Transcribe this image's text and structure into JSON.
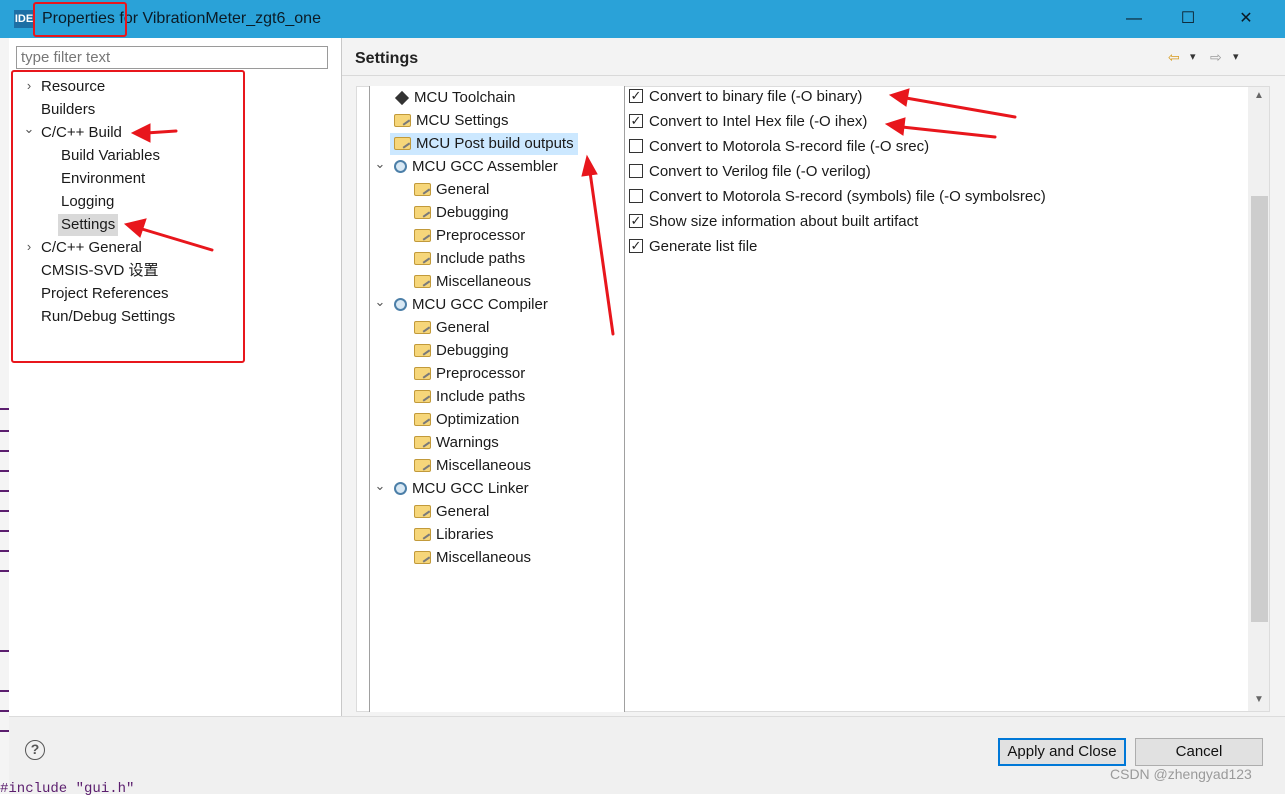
{
  "window": {
    "app_icon_text": "IDE",
    "title": "Properties for VibrationMeter_zgt6_one",
    "minimize": "—",
    "maximize": "☐",
    "close": "✕"
  },
  "filter": {
    "placeholder": "type filter text"
  },
  "left_tree": [
    {
      "label": "Resource",
      "twisty": "›"
    },
    {
      "label": "Builders",
      "twisty": ""
    },
    {
      "label": "C/C++ Build",
      "twisty": "⌄"
    },
    {
      "label": "Build Variables",
      "twisty": ""
    },
    {
      "label": "Environment",
      "twisty": ""
    },
    {
      "label": "Logging",
      "twisty": ""
    },
    {
      "label": "Settings",
      "twisty": "",
      "selected": true
    },
    {
      "label": "C/C++ General",
      "twisty": "›"
    },
    {
      "label": "CMSIS-SVD 设置",
      "twisty": ""
    },
    {
      "label": "Project References",
      "twisty": ""
    },
    {
      "label": "Run/Debug Settings",
      "twisty": ""
    }
  ],
  "page_title": "Settings",
  "nav": {
    "back": "⇦",
    "forward": "⇨",
    "menu": "▾"
  },
  "sub_tree": [
    {
      "label": "MCU Toolchain",
      "icon": "chip-icon"
    },
    {
      "label": "MCU Settings",
      "icon": "folder-settings-icon"
    },
    {
      "label": "MCU Post build outputs",
      "icon": "folder-settings-icon",
      "selected": true
    },
    {
      "label": "MCU GCC Assembler",
      "icon": "tool-gear-icon",
      "twisty": "⌄"
    },
    {
      "label": "General",
      "icon": "folder-settings-icon"
    },
    {
      "label": "Debugging",
      "icon": "folder-settings-icon"
    },
    {
      "label": "Preprocessor",
      "icon": "folder-settings-icon"
    },
    {
      "label": "Include paths",
      "icon": "folder-settings-icon"
    },
    {
      "label": "Miscellaneous",
      "icon": "folder-settings-icon"
    },
    {
      "label": "MCU GCC Compiler",
      "icon": "tool-gear-icon",
      "twisty": "⌄"
    },
    {
      "label": "General",
      "icon": "folder-settings-icon"
    },
    {
      "label": "Debugging",
      "icon": "folder-settings-icon"
    },
    {
      "label": "Preprocessor",
      "icon": "folder-settings-icon"
    },
    {
      "label": "Include paths",
      "icon": "folder-settings-icon"
    },
    {
      "label": "Optimization",
      "icon": "folder-settings-icon"
    },
    {
      "label": "Warnings",
      "icon": "folder-settings-icon"
    },
    {
      "label": "Miscellaneous",
      "icon": "folder-settings-icon"
    },
    {
      "label": "MCU GCC Linker",
      "icon": "tool-gear-icon",
      "twisty": "⌄"
    },
    {
      "label": "General",
      "icon": "folder-settings-icon"
    },
    {
      "label": "Libraries",
      "icon": "folder-settings-icon"
    },
    {
      "label": "Miscellaneous",
      "icon": "folder-settings-icon"
    }
  ],
  "options": [
    {
      "label": "Convert to binary file (-O binary)",
      "checked": true,
      "mark": "✓"
    },
    {
      "label": "Convert to Intel Hex file (-O ihex)",
      "checked": true,
      "mark": "✓"
    },
    {
      "label": "Convert to Motorola S-record file (-O srec)",
      "checked": false,
      "mark": ""
    },
    {
      "label": "Convert to Verilog file (-O verilog)",
      "checked": false,
      "mark": ""
    },
    {
      "label": "Convert to Motorola S-record (symbols) file (-O symbolsrec)",
      "checked": false,
      "mark": ""
    },
    {
      "label": "Show size information about built artifact",
      "checked": true,
      "mark": "✓"
    },
    {
      "label": "Generate list file",
      "checked": true,
      "mark": "✓"
    }
  ],
  "scroll": {
    "up": "▲",
    "down": "▼"
  },
  "buttons": {
    "help": "?",
    "apply_close": "Apply and Close",
    "cancel": "Cancel"
  },
  "code_snippet": "#include \"gui.h\"",
  "watermark": "CSDN @zhengyad123",
  "colors": {
    "titlebar": "#2aa2d8",
    "selection": "#cce8ff",
    "annotation": "#e8161c"
  }
}
